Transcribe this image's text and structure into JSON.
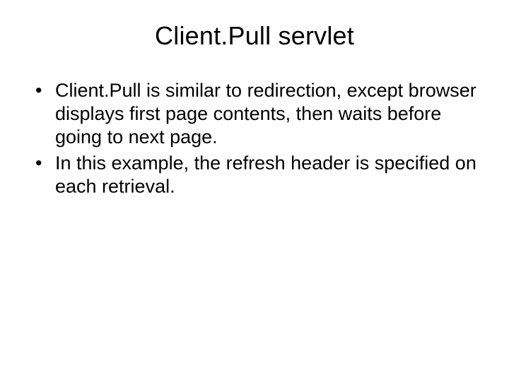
{
  "slide": {
    "title": "Client.Pull servlet",
    "bullets": [
      "Client.Pull is similar to redirection, except browser displays first page contents, then waits before going to next page.",
      "In this example, the refresh header is specified on each retrieval."
    ]
  }
}
